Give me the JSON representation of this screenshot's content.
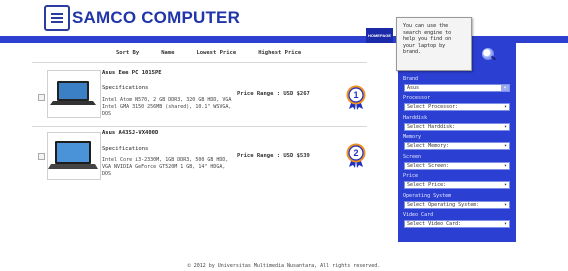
{
  "header": {
    "brand": "SAMCO COMPUTER",
    "nav": {
      "home_label": "HOMEPAGE"
    }
  },
  "tooltip": {
    "text": "You can use the search engine to help you find on your laptop by brand."
  },
  "sort_bar": {
    "label": "Sort By",
    "options": [
      "Name",
      "Lowest Price",
      "Highest Price"
    ]
  },
  "products": [
    {
      "name": "Asus Eee PC 1015PE",
      "spec_heading": "Specifications",
      "spec": "Intel Atom N570, 2 GB DDR3, 320 GB HDD, VGA Intel GMA 3150 256MB (shared), 10.1\" WSVGA, DOS",
      "price_text": "Price Range : USD $267",
      "rank": "1"
    },
    {
      "name": "Asus A43SJ-VX400D",
      "spec_heading": "Specifications",
      "spec": "Intel Core i3-2330M, 1GB DDR3, 500 GB HDD, VGA NVIDIA GeForce GT520M 1 GB, 14\" HDGA, DOS",
      "price_text": "Price Range : USD $539",
      "rank": "2"
    }
  ],
  "filters": [
    {
      "label": "Brand",
      "value": "Asus",
      "styled_arrow": true
    },
    {
      "label": "Processor",
      "value": "Select Processor:",
      "styled_arrow": false
    },
    {
      "label": "Harddisk",
      "value": "Select Harddisk:",
      "styled_arrow": false
    },
    {
      "label": "Memory",
      "value": "Select Memory:",
      "styled_arrow": false
    },
    {
      "label": "Screen",
      "value": "Select Screen:",
      "styled_arrow": false
    },
    {
      "label": "Price",
      "value": "Select Price:",
      "styled_arrow": false
    },
    {
      "label": "Operating System",
      "value": "Select Operating System:",
      "styled_arrow": false
    },
    {
      "label": "Video Card",
      "value": "Select Video Card:",
      "styled_arrow": false
    }
  ],
  "footer": {
    "text": "© 2012 by Universitas Multimedia Nusantara, All rights reserved."
  },
  "colors": {
    "brand_blue": "#1f35a8",
    "nav_blue": "#2c3fd0",
    "sidebar_blue": "#2b3fd3",
    "badge_orange": "#f0901e",
    "badge_blue": "#2030c0"
  },
  "icons": [
    "logo-icon",
    "search-icon",
    "rank-ribbon-icon",
    "chevron-down-icon"
  ]
}
